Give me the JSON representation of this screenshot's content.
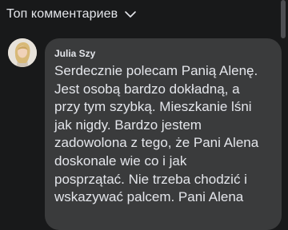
{
  "header": {
    "sort_label": "Топ комментариев",
    "sort_icon": "chevron-down-icon"
  },
  "comment": {
    "author": "Julia Szy",
    "avatar_icon": "user-avatar",
    "text": "Serdecznie polecam Panią Alenę.\nJest osobą bardzo dokładną, a\nprzy tym szybką. Mieszkanie lśni\njak nigdy. Bardzo jestem\nzadowolona z tego, że Pani Alena\ndoskonale wie co i jak\nposprzątać. Nie trzeba chodzić i\nwskazywać palcem. Pani Alena"
  },
  "colors": {
    "background": "#18191a",
    "bubble": "#3a3b3c",
    "text": "#e4e6eb"
  }
}
